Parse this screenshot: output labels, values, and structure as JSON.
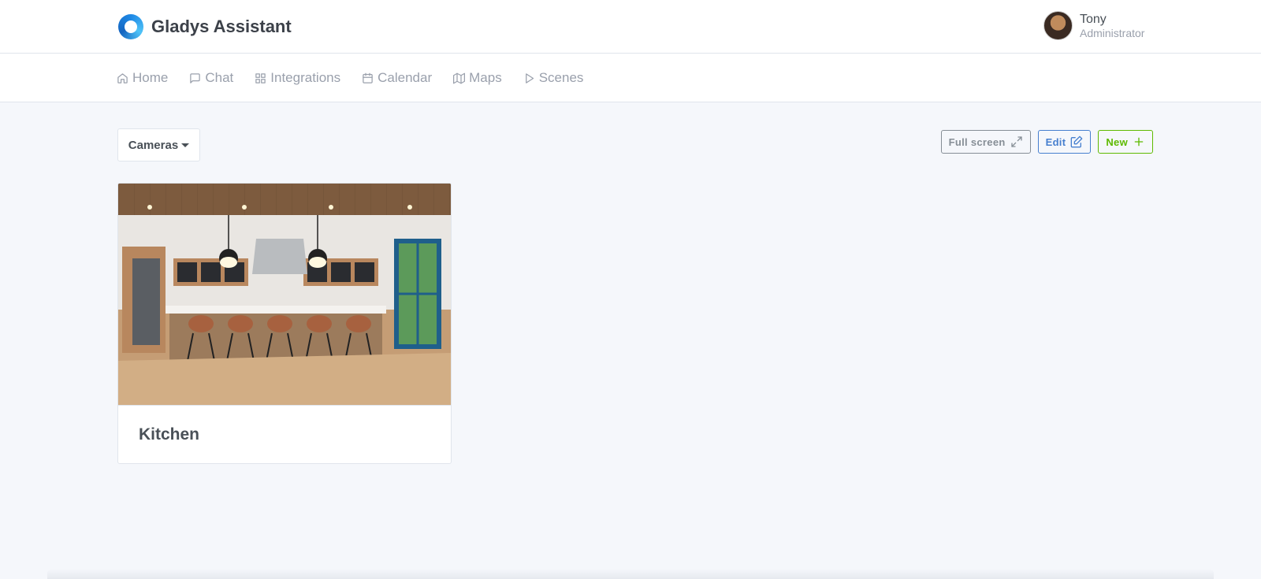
{
  "header": {
    "app_name": "Gladys Assistant",
    "logo_icon": "gladys-logo-icon",
    "user": {
      "name": "Tony",
      "role": "Administrator"
    }
  },
  "nav": {
    "items": [
      {
        "label": "Home",
        "icon": "home-icon"
      },
      {
        "label": "Chat",
        "icon": "chat-icon"
      },
      {
        "label": "Integrations",
        "icon": "grid-icon"
      },
      {
        "label": "Calendar",
        "icon": "calendar-icon"
      },
      {
        "label": "Maps",
        "icon": "map-icon"
      },
      {
        "label": "Scenes",
        "icon": "play-icon"
      }
    ]
  },
  "dashboard": {
    "selector_label": "Cameras",
    "actions": {
      "fullscreen_label": "Full screen",
      "edit_label": "Edit",
      "new_label": "New"
    },
    "colors": {
      "secondary": "#868e96",
      "primary": "#467fcf",
      "success": "#5eba00"
    }
  },
  "camera_card": {
    "title": "Kitchen",
    "image_description_icon": "camera-image"
  }
}
